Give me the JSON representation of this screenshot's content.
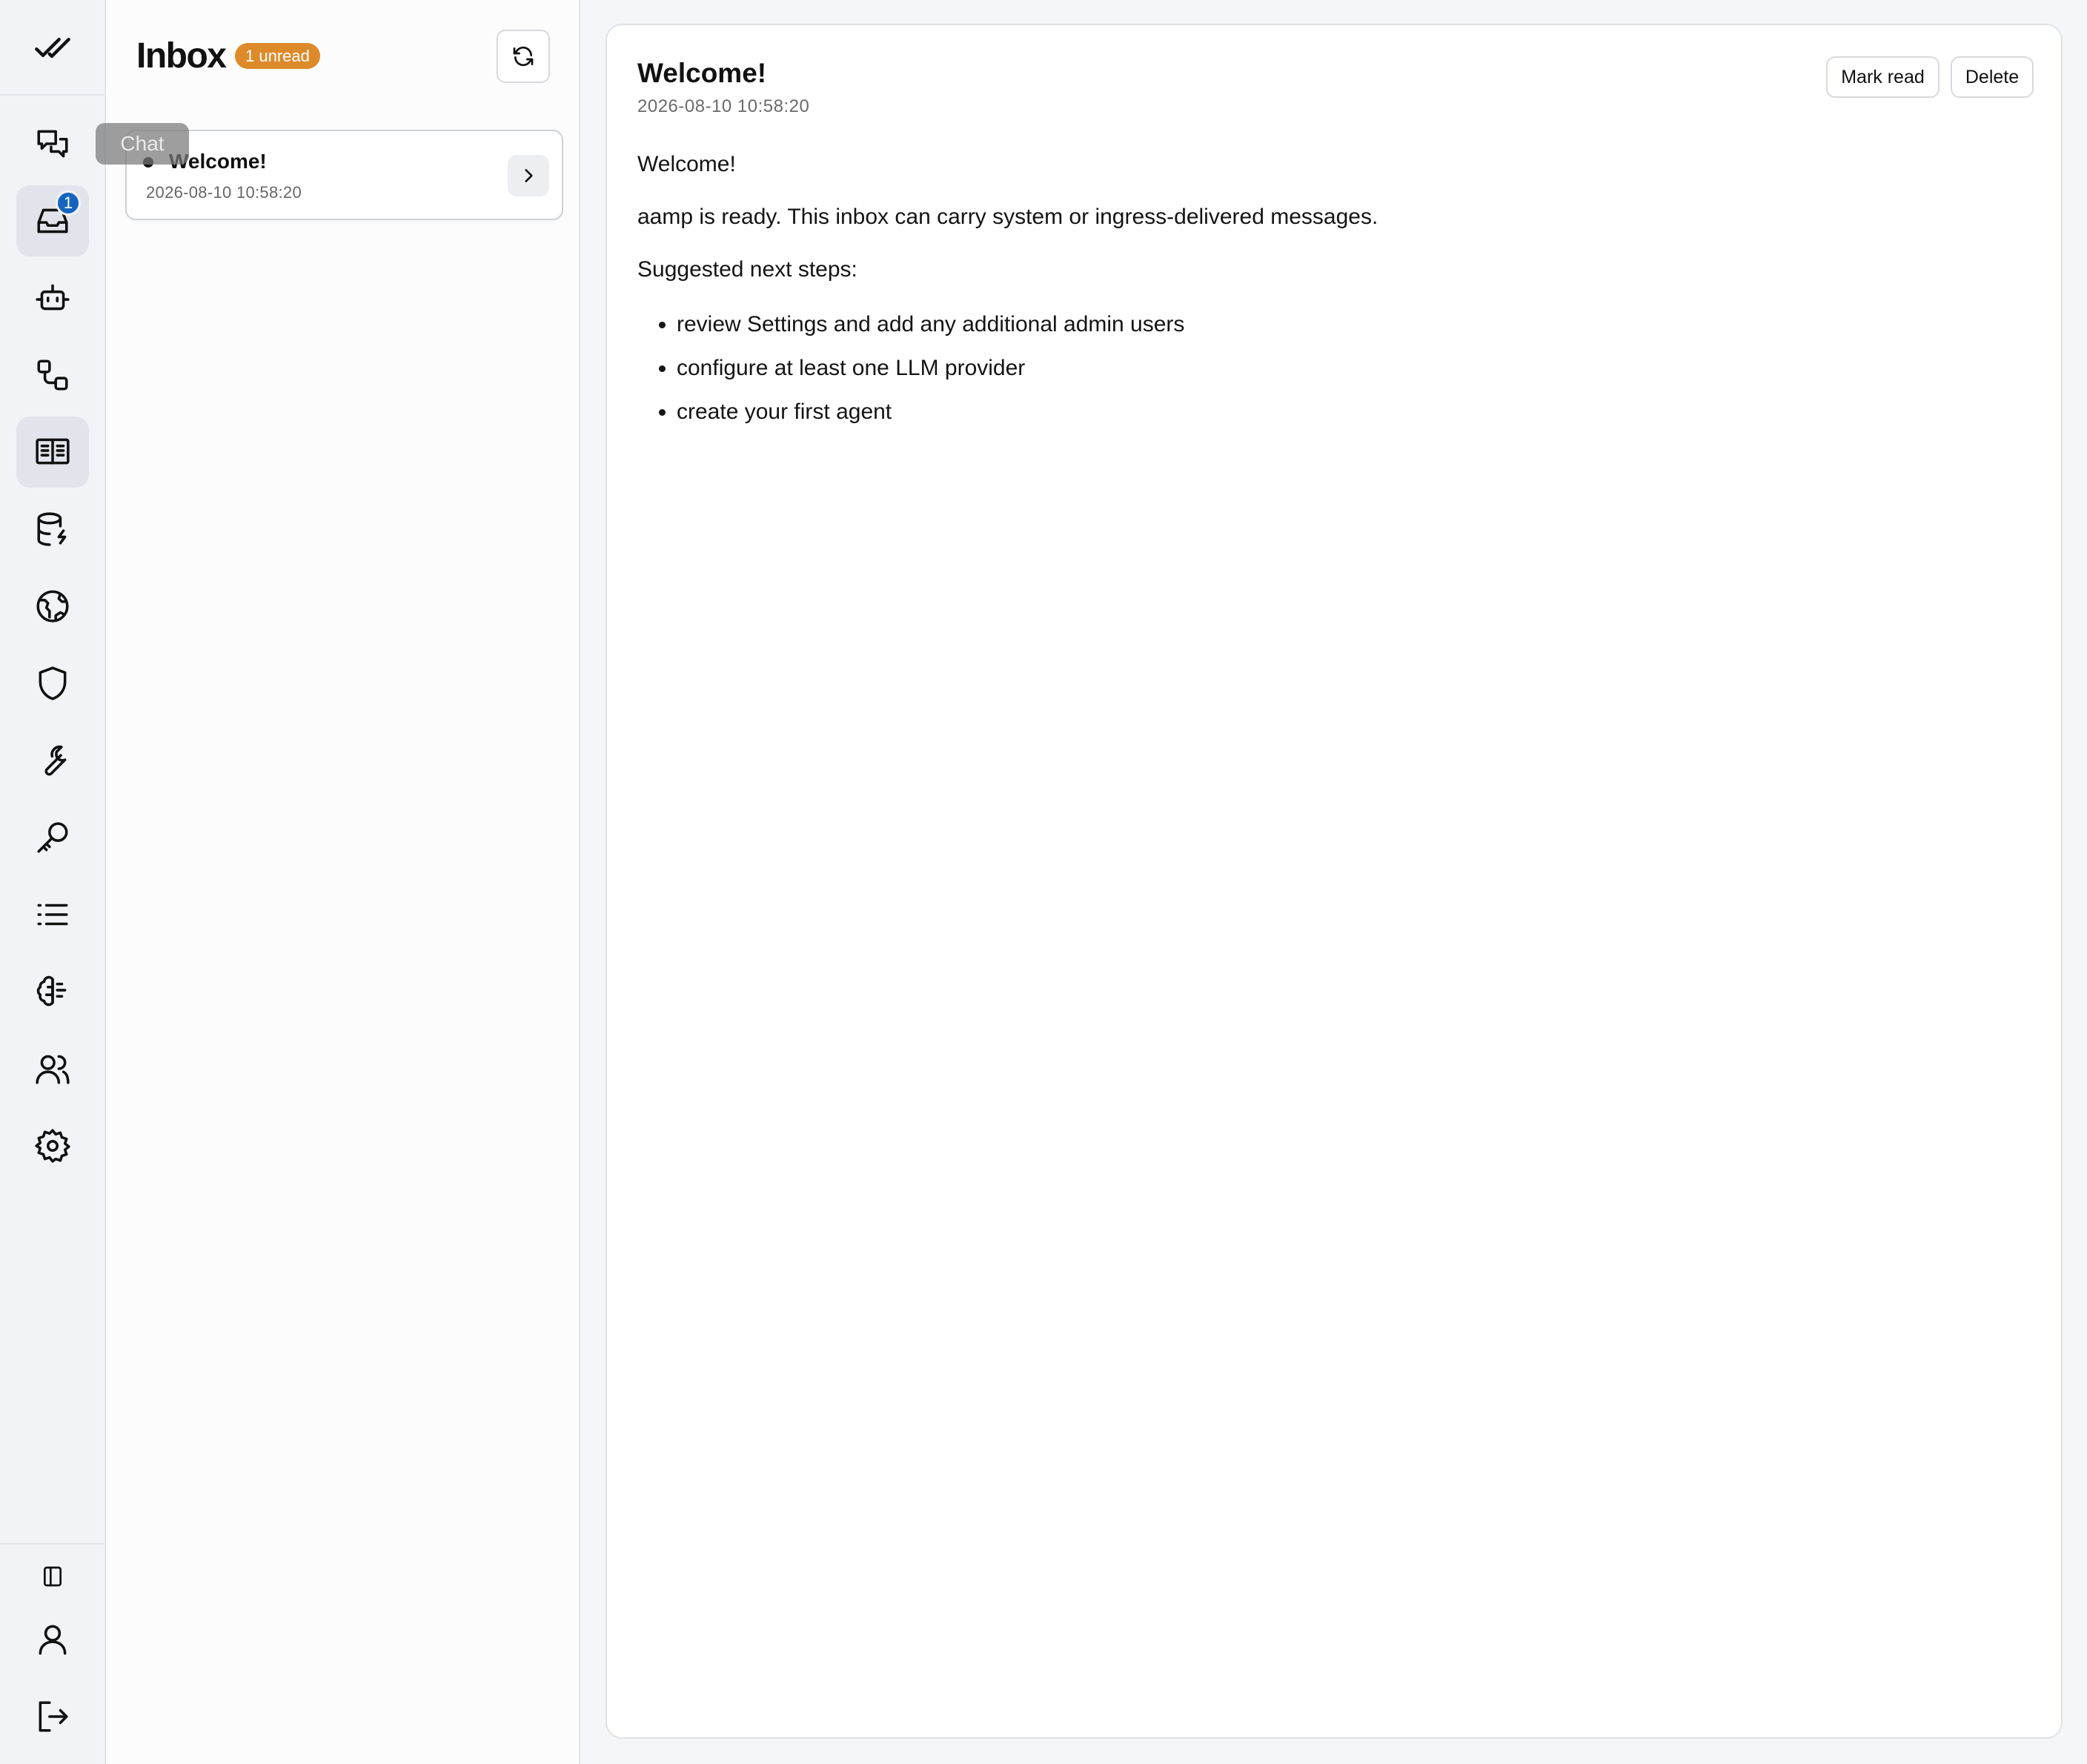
{
  "rail": {
    "items": [
      {
        "name": "chat",
        "icon": "chat-bubbles-icon"
      },
      {
        "name": "inbox",
        "icon": "inbox-tray-icon",
        "badge": "1"
      },
      {
        "name": "agents",
        "icon": "robot-icon"
      },
      {
        "name": "workflows",
        "icon": "workflow-icon"
      },
      {
        "name": "knowledge",
        "icon": "book-open-icon"
      },
      {
        "name": "data",
        "icon": "database-icon"
      },
      {
        "name": "network",
        "icon": "globe-icon"
      },
      {
        "name": "security",
        "icon": "shield-icon"
      },
      {
        "name": "tools",
        "icon": "wrench-icon"
      },
      {
        "name": "keys",
        "icon": "key-icon"
      },
      {
        "name": "logs",
        "icon": "list-icon"
      },
      {
        "name": "models",
        "icon": "brain-icon"
      },
      {
        "name": "users",
        "icon": "users-icon"
      },
      {
        "name": "settings",
        "icon": "gear-icon"
      }
    ],
    "tooltip": "Chat"
  },
  "inbox": {
    "title": "Inbox",
    "unread_label": "1 unread",
    "messages": [
      {
        "title": "Welcome!",
        "date": "2026-08-10 10:58:20",
        "unread": true
      }
    ]
  },
  "detail": {
    "title": "Welcome!",
    "date": "2026-08-10 10:58:20",
    "mark_read_label": "Mark read",
    "delete_label": "Delete",
    "body": {
      "greeting": "Welcome!",
      "intro": "aamp is ready. This inbox can carry system or ingress-delivered messages.",
      "steps_heading": "Suggested next steps:",
      "steps": [
        "review Settings and add any additional admin users",
        "configure at least one LLM provider",
        "create your first agent"
      ]
    }
  },
  "colors": {
    "accent_badge": "#dd8a2a",
    "notification": "#1565c0",
    "rail_bg": "#f1f3f6"
  }
}
